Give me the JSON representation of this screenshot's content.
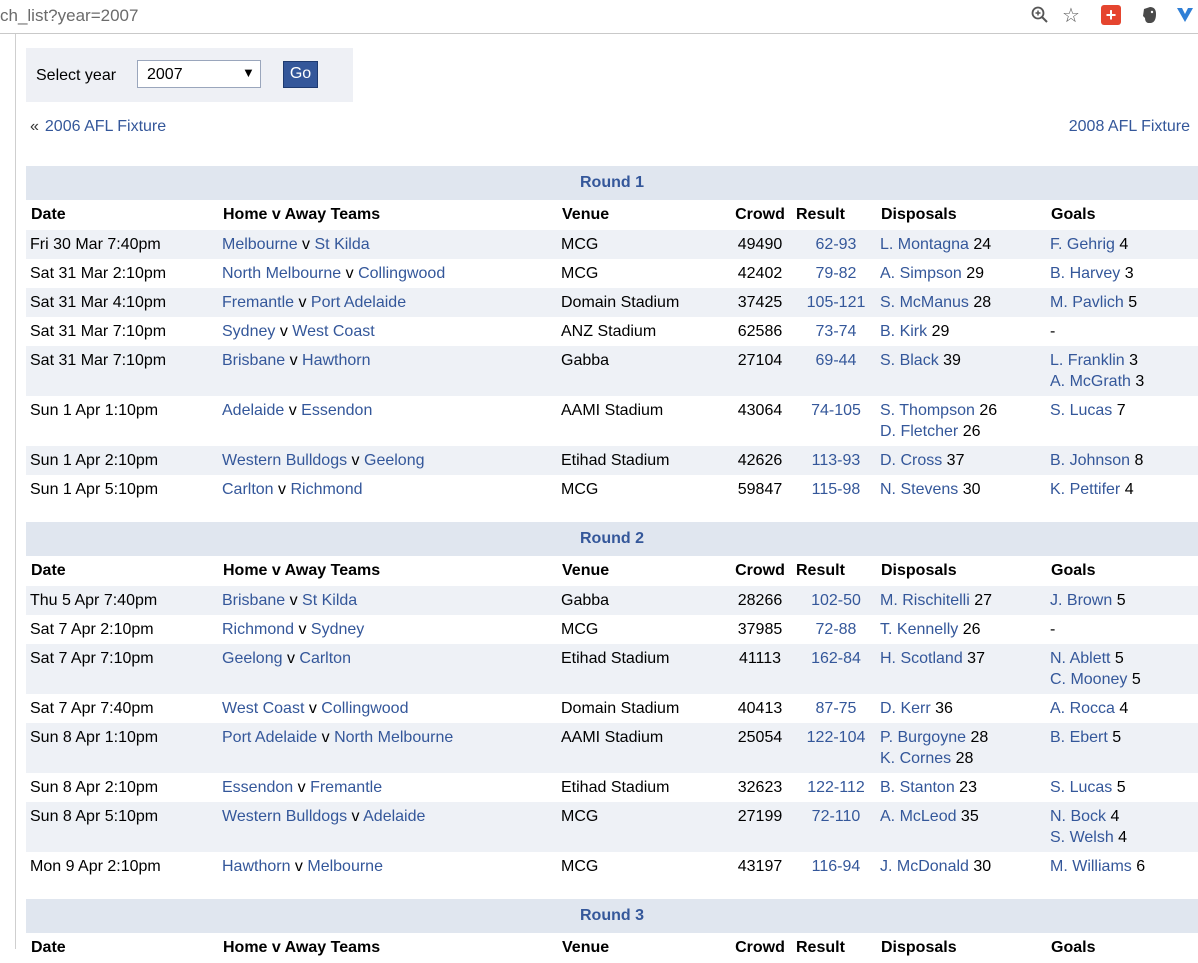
{
  "browser": {
    "url": "ch_list?year=2007"
  },
  "selector": {
    "label": "Select year",
    "value": "2007",
    "button": "Go"
  },
  "nav": {
    "prev_symbol": "«",
    "prev": "2006 AFL Fixture",
    "next": "2008 AFL Fixture"
  },
  "columns": {
    "date": "Date",
    "teams": "Home v Away Teams",
    "venue": "Venue",
    "crowd": "Crowd",
    "result": "Result",
    "disposals": "Disposals",
    "goals": "Goals"
  },
  "rounds": [
    {
      "title": "Round 1",
      "matches": [
        {
          "date": "Fri 30 Mar 7:40pm",
          "home": "Melbourne",
          "away": "St Kilda",
          "venue": "MCG",
          "crowd": "49490",
          "result": "62-93",
          "disposals": [
            {
              "player": "L. Montagna",
              "n": "24"
            }
          ],
          "goals": [
            {
              "player": "F. Gehrig",
              "n": "4"
            }
          ]
        },
        {
          "date": "Sat 31 Mar 2:10pm",
          "home": "North Melbourne",
          "away": "Collingwood",
          "venue": "MCG",
          "crowd": "42402",
          "result": "79-82",
          "disposals": [
            {
              "player": "A. Simpson",
              "n": "29"
            }
          ],
          "goals": [
            {
              "player": "B. Harvey",
              "n": "3"
            }
          ]
        },
        {
          "date": "Sat 31 Mar 4:10pm",
          "home": "Fremantle",
          "away": "Port Adelaide",
          "venue": "Domain Stadium",
          "crowd": "37425",
          "result": "105-121",
          "disposals": [
            {
              "player": "S. McManus",
              "n": "28"
            }
          ],
          "goals": [
            {
              "player": "M. Pavlich",
              "n": "5"
            }
          ]
        },
        {
          "date": "Sat 31 Mar 7:10pm",
          "home": "Sydney",
          "away": "West Coast",
          "venue": "ANZ Stadium",
          "crowd": "62586",
          "result": "73-74",
          "disposals": [
            {
              "player": "B. Kirk",
              "n": "29"
            }
          ],
          "goals": [],
          "goals_none": "-"
        },
        {
          "date": "Sat 31 Mar 7:10pm",
          "home": "Brisbane",
          "away": "Hawthorn",
          "venue": "Gabba",
          "crowd": "27104",
          "result": "69-44",
          "disposals": [
            {
              "player": "S. Black",
              "n": "39"
            }
          ],
          "goals": [
            {
              "player": "L. Franklin",
              "n": "3"
            },
            {
              "player": "A. McGrath",
              "n": "3"
            }
          ]
        },
        {
          "date": "Sun 1 Apr 1:10pm",
          "home": "Adelaide",
          "away": "Essendon",
          "venue": "AAMI Stadium",
          "crowd": "43064",
          "result": "74-105",
          "disposals": [
            {
              "player": "S. Thompson",
              "n": "26"
            },
            {
              "player": "D. Fletcher",
              "n": "26"
            }
          ],
          "goals": [
            {
              "player": "S. Lucas",
              "n": "7"
            }
          ]
        },
        {
          "date": "Sun 1 Apr 2:10pm",
          "home": "Western Bulldogs",
          "away": "Geelong",
          "venue": "Etihad Stadium",
          "crowd": "42626",
          "result": "113-93",
          "disposals": [
            {
              "player": "D. Cross",
              "n": "37"
            }
          ],
          "goals": [
            {
              "player": "B. Johnson",
              "n": "8"
            }
          ]
        },
        {
          "date": "Sun 1 Apr 5:10pm",
          "home": "Carlton",
          "away": "Richmond",
          "venue": "MCG",
          "crowd": "59847",
          "result": "115-98",
          "disposals": [
            {
              "player": "N. Stevens",
              "n": "30"
            }
          ],
          "goals": [
            {
              "player": "K. Pettifer",
              "n": "4"
            }
          ]
        }
      ]
    },
    {
      "title": "Round 2",
      "matches": [
        {
          "date": "Thu 5 Apr 7:40pm",
          "home": "Brisbane",
          "away": "St Kilda",
          "venue": "Gabba",
          "crowd": "28266",
          "result": "102-50",
          "disposals": [
            {
              "player": "M. Rischitelli",
              "n": "27"
            }
          ],
          "goals": [
            {
              "player": "J. Brown",
              "n": "5"
            }
          ]
        },
        {
          "date": "Sat 7 Apr 2:10pm",
          "home": "Richmond",
          "away": "Sydney",
          "venue": "MCG",
          "crowd": "37985",
          "result": "72-88",
          "disposals": [
            {
              "player": "T. Kennelly",
              "n": "26"
            }
          ],
          "goals": [],
          "goals_none": "-"
        },
        {
          "date": "Sat 7 Apr 7:10pm",
          "home": "Geelong",
          "away": "Carlton",
          "venue": "Etihad Stadium",
          "crowd": "41113",
          "result": "162-84",
          "disposals": [
            {
              "player": "H. Scotland",
              "n": "37"
            }
          ],
          "goals": [
            {
              "player": "N. Ablett",
              "n": "5"
            },
            {
              "player": "C. Mooney",
              "n": "5"
            }
          ]
        },
        {
          "date": "Sat 7 Apr 7:40pm",
          "home": "West Coast",
          "away": "Collingwood",
          "venue": "Domain Stadium",
          "crowd": "40413",
          "result": "87-75",
          "disposals": [
            {
              "player": "D. Kerr",
              "n": "36"
            }
          ],
          "goals": [
            {
              "player": "A. Rocca",
              "n": "4"
            }
          ]
        },
        {
          "date": "Sun 8 Apr 1:10pm",
          "home": "Port Adelaide",
          "away": "North Melbourne",
          "venue": "AAMI Stadium",
          "crowd": "25054",
          "result": "122-104",
          "disposals": [
            {
              "player": "P. Burgoyne",
              "n": "28"
            },
            {
              "player": "K. Cornes",
              "n": "28"
            }
          ],
          "goals": [
            {
              "player": "B. Ebert",
              "n": "5"
            }
          ]
        },
        {
          "date": "Sun 8 Apr 2:10pm",
          "home": "Essendon",
          "away": "Fremantle",
          "venue": "Etihad Stadium",
          "crowd": "32623",
          "result": "122-112",
          "disposals": [
            {
              "player": "B. Stanton",
              "n": "23"
            }
          ],
          "goals": [
            {
              "player": "S. Lucas",
              "n": "5"
            }
          ]
        },
        {
          "date": "Sun 8 Apr 5:10pm",
          "home": "Western Bulldogs",
          "away": "Adelaide",
          "venue": "MCG",
          "crowd": "27199",
          "result": "72-110",
          "disposals": [
            {
              "player": "A. McLeod",
              "n": "35"
            }
          ],
          "goals": [
            {
              "player": "N. Bock",
              "n": "4"
            },
            {
              "player": "S. Welsh",
              "n": "4"
            }
          ]
        },
        {
          "date": "Mon 9 Apr 2:10pm",
          "home": "Hawthorn",
          "away": "Melbourne",
          "venue": "MCG",
          "crowd": "43197",
          "result": "116-94",
          "disposals": [
            {
              "player": "J. McDonald",
              "n": "30"
            }
          ],
          "goals": [
            {
              "player": "M. Williams",
              "n": "6"
            }
          ]
        }
      ]
    },
    {
      "title": "Round 3",
      "matches": []
    }
  ]
}
